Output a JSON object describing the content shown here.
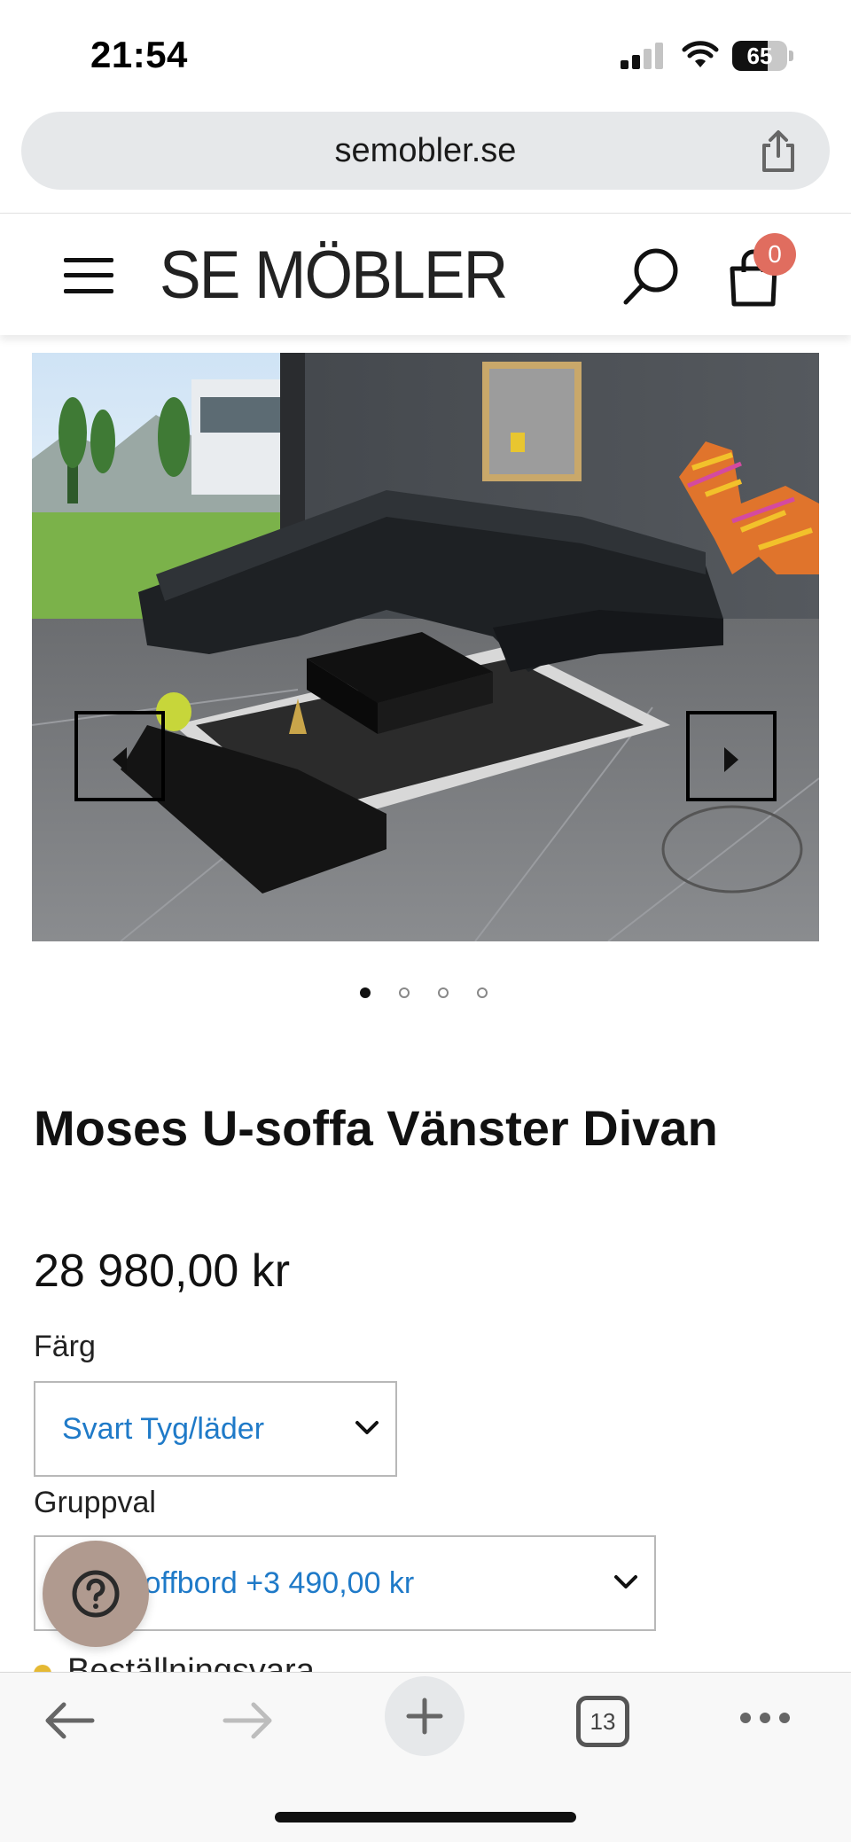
{
  "status_bar": {
    "time": "21:54",
    "battery_level": "65"
  },
  "browser": {
    "url": "semobler.se",
    "tab_count": "13"
  },
  "site": {
    "logo": "SE MÖBLER",
    "cart_count": "0"
  },
  "carousel": {
    "slide_count": 4,
    "active_slide": 1
  },
  "product": {
    "title": "Moses U-soffa Vänster Divan",
    "price": "28 980,00 kr"
  },
  "options": {
    "color_label": "Färg",
    "color_value": "Svart Tyg/läder",
    "group_label": "Gruppval",
    "group_value": "Med soffbord +3 490,00 kr"
  },
  "notice": {
    "text": "Beställningsvara"
  },
  "colors": {
    "link_blue": "#1f7ac8",
    "badge_red": "#e06d5f",
    "help_button": "#b09a8f",
    "notice_dot": "#e5b933"
  },
  "icons": {
    "menu": "hamburger-icon",
    "search": "search-icon",
    "cart": "shopping-bag-icon",
    "share": "share-icon",
    "help": "question-mark-icon",
    "back": "arrow-left-icon",
    "forward": "arrow-right-icon",
    "new_tab": "plus-icon",
    "tabs": "tabs-icon",
    "more": "more-dots-icon"
  }
}
